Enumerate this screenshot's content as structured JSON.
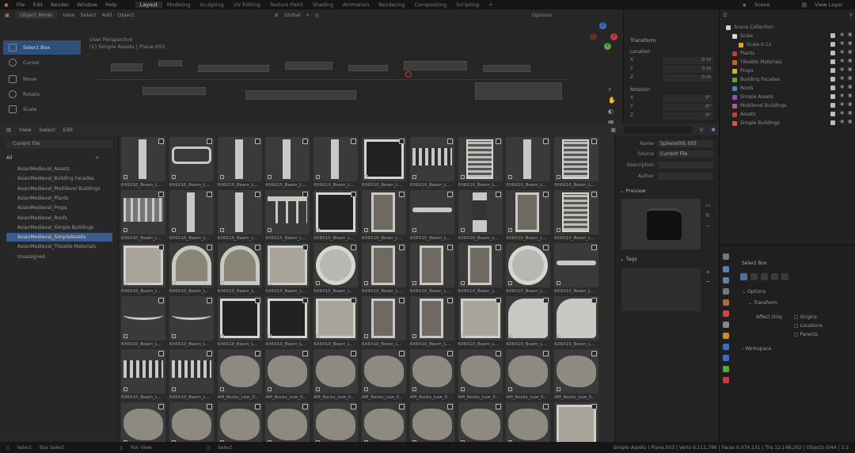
{
  "menu": {
    "items": [
      "File",
      "Edit",
      "Render",
      "Window",
      "Help"
    ],
    "workspaces": [
      "Layout",
      "Modeling",
      "Sculpting",
      "UV Editing",
      "Texture Paint",
      "Shading",
      "Animation",
      "Rendering",
      "Compositing",
      "Scripting"
    ],
    "active_workspace": "Layout",
    "scene": "Scene",
    "view_layer": "View Layer"
  },
  "viewport": {
    "mode": "Object Mode",
    "menu": [
      "View",
      "Select",
      "Add",
      "Object"
    ],
    "transform_orientation": "Global",
    "view_name": "User Perspective",
    "context": "(1) Simple Assets | Plane.003",
    "options_label": "Options",
    "tools": [
      "Select Box",
      "Cursor",
      "Move",
      "Rotate",
      "Scale"
    ]
  },
  "npanel": {
    "title": "Transform",
    "location_label": "Location",
    "rotation_label": "Rotation",
    "axes": [
      "X",
      "Y",
      "Z"
    ],
    "location_values": [
      "0 m",
      "0 m",
      "0 m"
    ],
    "rotation_values": [
      "0°",
      "0°",
      "0°"
    ]
  },
  "outliner": {
    "title": "Scene Collection",
    "items": [
      {
        "label": "Scale",
        "color": "#d9d9d9",
        "indent": 1
      },
      {
        "label": "Scale 0.12",
        "color": "#e0a030",
        "indent": 2
      },
      {
        "label": "Plants",
        "color": "#c63b3b",
        "indent": 1
      },
      {
        "label": "Tileable Materials",
        "color": "#c7632b",
        "indent": 1
      },
      {
        "label": "Props",
        "color": "#c9b92b",
        "indent": 1
      },
      {
        "label": "Building Facades",
        "color": "#5aa63b",
        "indent": 1
      },
      {
        "label": "Roofs",
        "color": "#3b8cc6",
        "indent": 1
      },
      {
        "label": "Simple Assets",
        "color": "#8a4fc6",
        "indent": 1
      },
      {
        "label": "Multilevel Buildings",
        "color": "#c64f9a",
        "indent": 1
      },
      {
        "label": "Assets",
        "color": "#c63b3b",
        "indent": 1
      },
      {
        "label": "Simple Buildings",
        "color": "#c7632b",
        "indent": 1
      }
    ]
  },
  "asset_browser": {
    "menu": [
      "View",
      "Select",
      "Edit"
    ],
    "library": "Current File",
    "catalog_root": "All",
    "catalogs": [
      "AsianMedieval_Assets",
      "AsianMedieval_Building Facades",
      "AsianMedieval_Multilevel Buildings",
      "AsianMedieval_Plants",
      "AsianMedieval_Props",
      "AsianMedieval_Roofs",
      "AsianMedieval_Simple Buildings",
      "AsianMedieval_SimpleAssets",
      "AsianMedieval_Tileable Materials",
      "Unassigned"
    ],
    "selected_catalog": "AsianMedieval_SimpleAssets",
    "assets": [
      "6X6X10_Beam_L...",
      "6X6X10_Beam_L...",
      "6X6X10_Beam_L...",
      "6X6X10_Beam_L...",
      "6X6X10_Beam_L...",
      "6X6X10_Beam_L...",
      "6X6X10_Beam_L...",
      "6X6X10_Beam_L...",
      "6X6X10_Beam_L...",
      "6X6X10_Beam_L...",
      "6X6X10_Beam_L...",
      "6X6X10_Beam_L...",
      "6X6X10_Beam_L...",
      "6X6X10_Beam_L...",
      "6X6X10_Beam_L...",
      "6X6X10_Beam_L...",
      "6X6X10_Beam_L...",
      "6X6X10_Beam_L...",
      "6X6X10_Beam_L...",
      "6X6X10_Beam_L...",
      "6X6X10_Beam_L...",
      "6X6X10_Beam_L...",
      "6X6X10_Beam_L...",
      "6X6X10_Beam_L...",
      "6X6X10_Beam_L...",
      "6X6X10_Beam_L...",
      "6X6X10_Beam_L...",
      "6X6X10_Beam_L...",
      "6X6X10_Beam_L...",
      "6X6X10_Beam_L...",
      "6X6X10_Beam_L...",
      "6X6X10_Beam_L...",
      "6X6X10_Beam_L...",
      "6X6X10_Beam_L...",
      "6X6X10_Beam_L...",
      "6X6X10_Beam_L...",
      "6X6X10_Beam_L...",
      "6X6X10_Beam_L...",
      "6X6X10_Beam_L...",
      "6X6X10_Beam_L...",
      "6X6X10_Beam_L...",
      "6X6X10_Beam_L...",
      "AM_Rocks_Low_0...",
      "AM_Rocks_Low_0...",
      "AM_Rocks_Low_0...",
      "AM_Rocks_Low_0...",
      "AM_Rocks_Low_0...",
      "AM_Rocks_Low_0...",
      "AM_Rocks_Low_0...",
      "AM_Rocks_Low_0...",
      "",
      "",
      "",
      "",
      "",
      "",
      "",
      "",
      "",
      ""
    ]
  },
  "asset_details": {
    "name_label": "Name",
    "name_value": "Sphere005.003",
    "source_label": "Source",
    "source_value": "Current File",
    "description_label": "Description",
    "author_label": "Author",
    "preview_title": "Preview",
    "tags_title": "Tags"
  },
  "properties": {
    "tool_name": "Select Box",
    "options_title": "Options",
    "transform_title": "Transform",
    "affect_only_label": "Affect Only",
    "affect_options": [
      "Origins",
      "Locations",
      "Parents"
    ],
    "workspace_title": "Workspace"
  },
  "status": {
    "select": "Select",
    "box_select": "Box Select",
    "pan_view": "Pan View",
    "select2": "Select",
    "stats": "Simple Assets | Plane.003 | Verts 6,111,786 | Faces 6,074,131 | Tris 12,148,262 | Objects 0/44 | 3.3"
  },
  "colors": {
    "accent": "#3c5c8c",
    "active_tool": "#2f4e7a"
  }
}
